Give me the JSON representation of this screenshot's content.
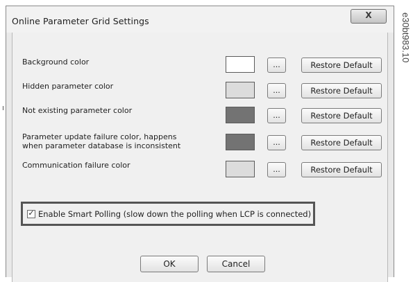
{
  "window": {
    "title": "Online Parameter Grid Settings",
    "close_glyph": "X"
  },
  "rows": [
    {
      "label_lines": [
        "Background color"
      ],
      "swatch_color": "#ffffff",
      "browse_label": "...",
      "restore_label": "Restore Default"
    },
    {
      "label_lines": [
        "Hidden parameter color"
      ],
      "swatch_color": "#dcdcdc",
      "browse_label": "...",
      "restore_label": "Restore Default"
    },
    {
      "label_lines": [
        "Not existing parameter color"
      ],
      "swatch_color": "#737373",
      "browse_label": "...",
      "restore_label": "Restore Default"
    },
    {
      "label_lines": [
        "Parameter update failure color, happens",
        "when parameter database is inconsistent"
      ],
      "swatch_color": "#737373",
      "browse_label": "...",
      "restore_label": "Restore Default"
    },
    {
      "label_lines": [
        "Communication failure color"
      ],
      "swatch_color": "#dcdcdc",
      "browse_label": "...",
      "restore_label": "Restore Default"
    }
  ],
  "smart_polling": {
    "checked": true,
    "check_glyph": "✓",
    "label": "Enable Smart Polling (slow down the polling when LCP is connected)"
  },
  "buttons": {
    "ok": "OK",
    "cancel": "Cancel"
  },
  "figure_code": "e30bt983.10"
}
